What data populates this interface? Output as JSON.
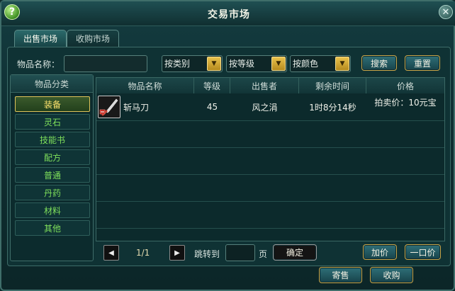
{
  "window": {
    "title": "交易市场",
    "help_glyph": "?",
    "close_glyph": "✕"
  },
  "tabs": [
    {
      "label": "出售市场",
      "active": true
    },
    {
      "label": "收购市场",
      "active": false
    }
  ],
  "search": {
    "item_name_label": "物品名称：",
    "item_name_value": "",
    "filters": [
      {
        "value": "按类别"
      },
      {
        "value": "按等级"
      },
      {
        "value": "按颜色"
      }
    ],
    "search_button": "搜索",
    "reset_button": "重置"
  },
  "sidebar": {
    "header": "物品分类",
    "items": [
      {
        "label": "装备",
        "selected": true
      },
      {
        "label": "灵石"
      },
      {
        "label": "技能书"
      },
      {
        "label": "配方"
      },
      {
        "label": "普通"
      },
      {
        "label": "丹药"
      },
      {
        "label": "材料"
      },
      {
        "label": "其他"
      }
    ]
  },
  "table": {
    "columns": [
      "物品名称",
      "等级",
      "出售者",
      "剩余时间",
      "价格"
    ],
    "rows": [
      {
        "icon": "blade-icon",
        "name": "斩马刀",
        "level": "45",
        "seller": "风之涓",
        "time_left": "1时8分14秒",
        "price": "拍卖价：10元宝"
      }
    ]
  },
  "pagination": {
    "page": "1/1",
    "jump_label": "跳转到",
    "page_suffix": "页",
    "page_input": "",
    "confirm_button": "确定"
  },
  "actions": {
    "bid_button": "加价",
    "buyout_button": "一口价",
    "sell_button": "寄售",
    "buy_button": "收购"
  },
  "colors": {
    "accent_gold": "#e0c35a",
    "category_green": "#7fe05b",
    "selected_yellow": "#ffe46e"
  }
}
